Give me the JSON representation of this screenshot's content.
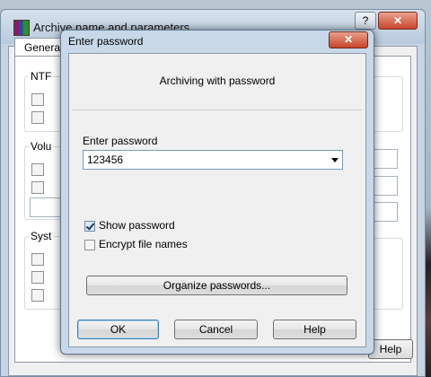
{
  "background_window": {
    "title": "Archive name and parameters",
    "help_label": "?",
    "close_label": "✕",
    "tab_label": "General",
    "group_labels": [
      "NTF",
      "Volu",
      "Syst"
    ],
    "help_button_label": "Help"
  },
  "dialog": {
    "title": "Enter password",
    "close_label": "✕",
    "subtitle": "Archiving with password",
    "password_label": "Enter password",
    "password_value": "123456",
    "show_password_label": "Show password",
    "show_password_checked": true,
    "encrypt_names_label": "Encrypt file names",
    "encrypt_names_checked": false,
    "organize_button": "Organize passwords...",
    "ok_button": "OK",
    "cancel_button": "Cancel",
    "help_button": "Help"
  },
  "colors": {
    "title_bar": "#c8d8e8",
    "close_button": "#c7432a",
    "default_button_border": "#3c7fb1"
  }
}
